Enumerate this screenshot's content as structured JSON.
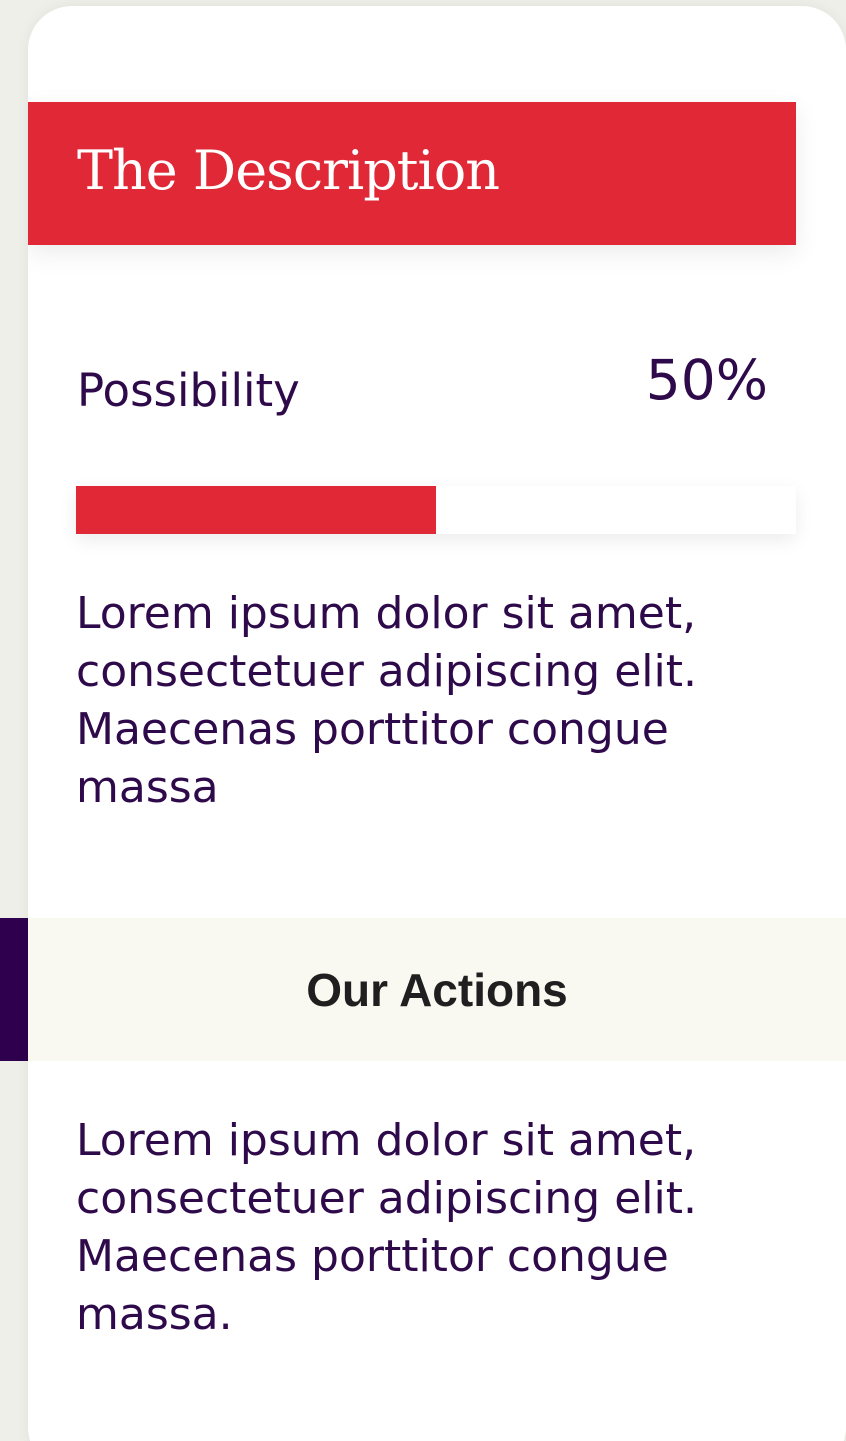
{
  "description": {
    "title": "The Description",
    "possibility_label": "Possibility",
    "possibility_value": "50%",
    "progress_percent": 50,
    "text": "Lorem ipsum dolor sit amet, consectetuer adipiscing elit. Maecenas porttitor congue massa"
  },
  "actions": {
    "title": "Our Actions",
    "text": "Lorem ipsum dolor sit amet, consectetuer adipiscing elit. Maecenas porttitor congue massa."
  },
  "colors": {
    "accent": "#e02837",
    "text": "#2e0a4b",
    "page_background": "#efefe9",
    "section_band": "#f9f9f1",
    "side_accent": "#2e004d"
  }
}
